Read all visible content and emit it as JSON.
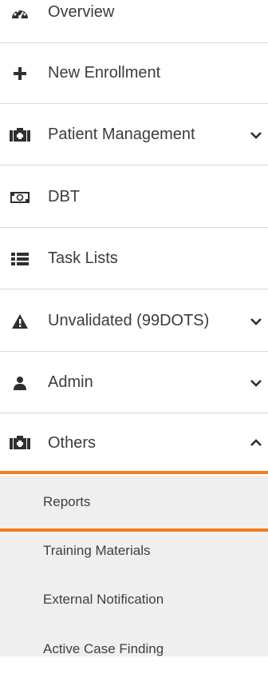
{
  "menu": {
    "items": [
      {
        "label": "Overview",
        "icon": "dashboard-icon"
      },
      {
        "label": "New Enrollment",
        "icon": "plus-icon"
      },
      {
        "label": "Patient Management",
        "icon": "medkit-icon"
      },
      {
        "label": "DBT",
        "icon": "money-icon"
      },
      {
        "label": "Task Lists",
        "icon": "list-icon"
      },
      {
        "label": "Unvalidated (99DOTS)",
        "icon": "warning-icon"
      },
      {
        "label": "Admin",
        "icon": "user-icon"
      },
      {
        "label": "Others",
        "icon": "medkit-icon"
      }
    ],
    "submenu": [
      {
        "label": "Reports"
      },
      {
        "label": "Training Materials"
      },
      {
        "label": "External Notification"
      },
      {
        "label": "Active Case Finding"
      }
    ]
  },
  "colors": {
    "accent": "#f47b20",
    "submenu_bg": "#efefef",
    "divider": "#d9d9d9",
    "icon": "#2f2f2f"
  }
}
